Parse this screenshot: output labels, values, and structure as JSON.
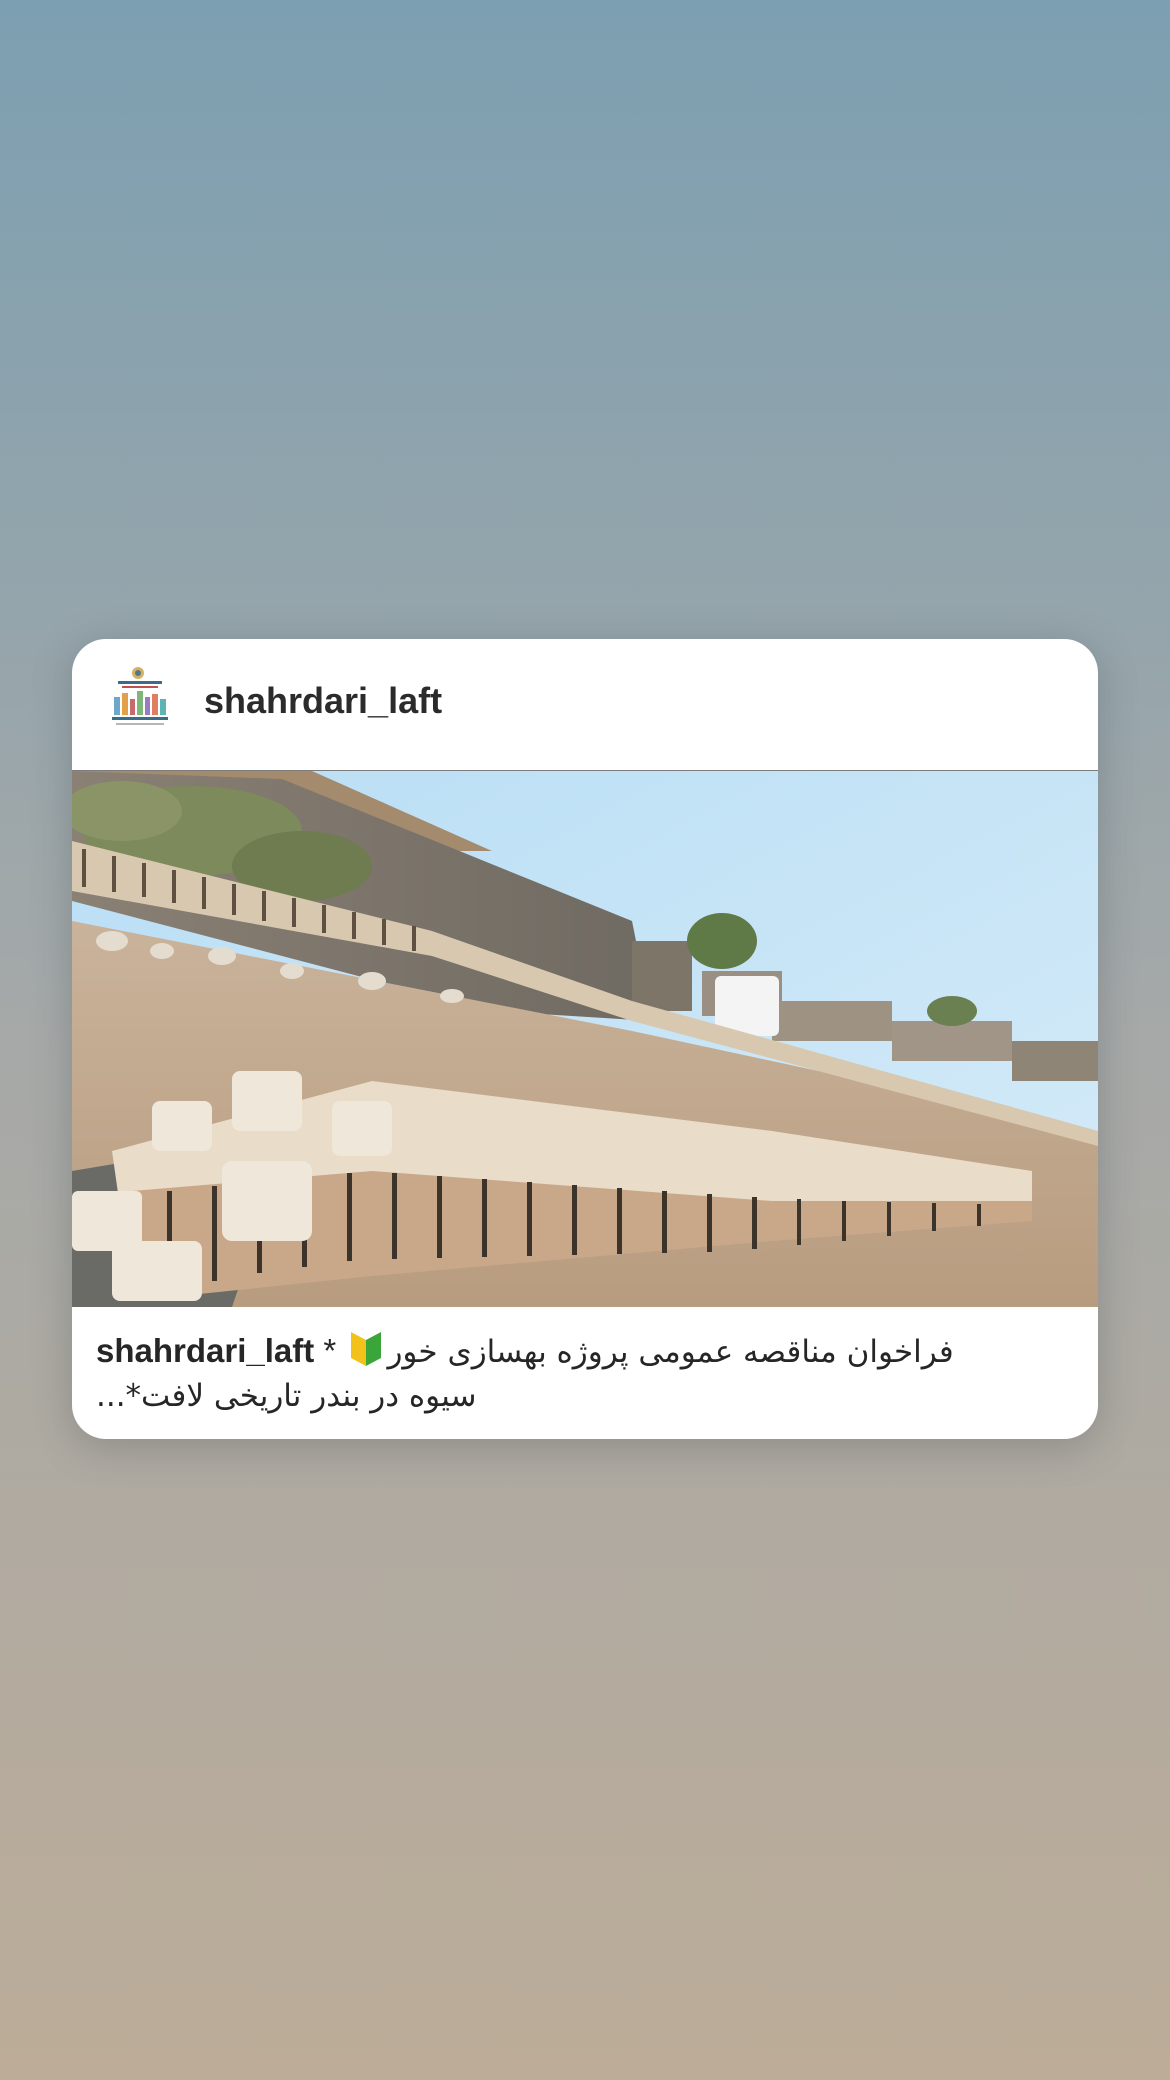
{
  "colors": {
    "bg_top": "#7c9eb0",
    "bg_mid": "#a8a9a6",
    "bg_bottom": "#bcac98",
    "card": "#ffffff",
    "text": "#262626"
  },
  "post": {
    "username": "shahrdari_laft",
    "avatar_icon": "municipality-logo-icon",
    "caption": {
      "username": "shahrdari_laft",
      "asterisk": "*",
      "emoji_icon": "beginner-badge-icon",
      "line1_text": "فراخوان مناقصه عمومی پروژه بهسازی خور",
      "line2_text": "سیوه در بندر تاریخی لافت*..."
    }
  }
}
